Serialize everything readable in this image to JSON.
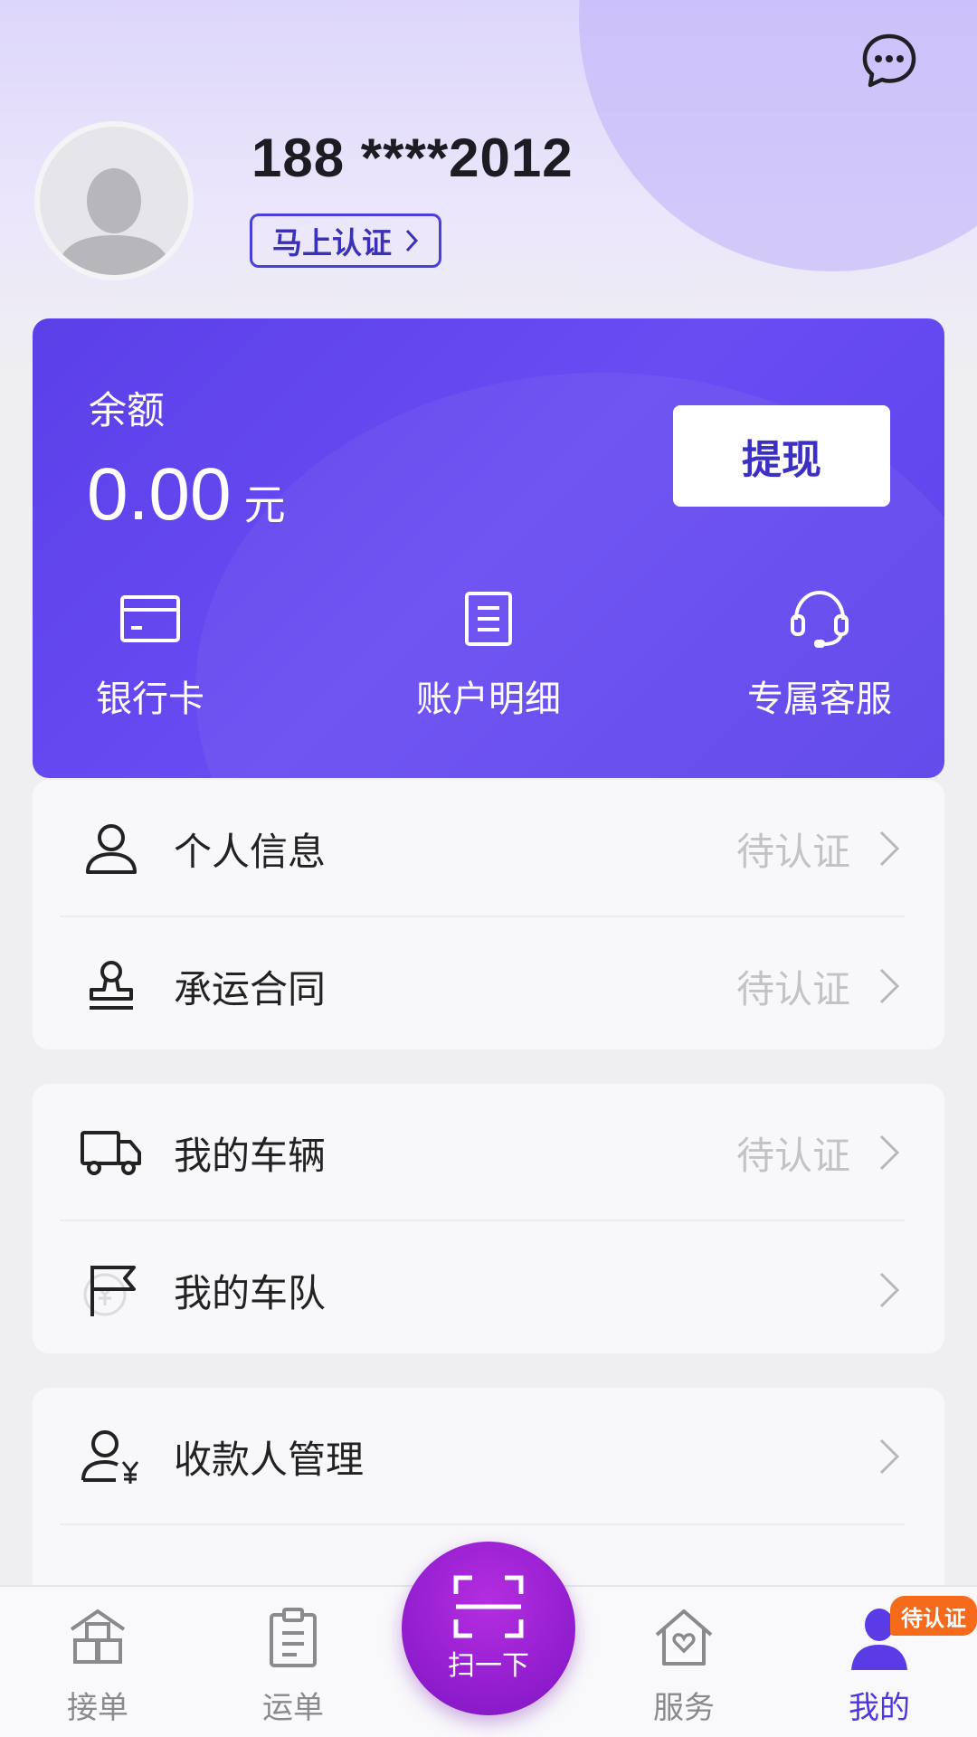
{
  "header": {
    "phone": "188 ****2012",
    "verify_label": "马上认证"
  },
  "balance": {
    "label": "余额",
    "amount": "0.00",
    "unit": "元",
    "withdraw_label": "提现",
    "actions": [
      {
        "label": "银行卡",
        "icon": "credit-card-icon"
      },
      {
        "label": "账户明细",
        "icon": "document-icon"
      },
      {
        "label": "专属客服",
        "icon": "headset-icon"
      }
    ]
  },
  "menu_groups": [
    [
      {
        "label": "个人信息",
        "status": "待认证",
        "icon": "person-icon"
      },
      {
        "label": "承运合同",
        "status": "待认证",
        "icon": "stamp-icon"
      }
    ],
    [
      {
        "label": "我的车辆",
        "status": "待认证",
        "icon": "truck-icon"
      },
      {
        "label": "我的车队",
        "status": "",
        "icon": "flag-icon"
      }
    ],
    [
      {
        "label": "收款人管理",
        "status": "",
        "icon": "payee-icon"
      }
    ]
  ],
  "tabbar": {
    "tabs": [
      {
        "label": "接单",
        "icon": "boxes-icon"
      },
      {
        "label": "运单",
        "icon": "clipboard-icon"
      },
      {
        "label": "服务",
        "icon": "house-heart-icon"
      },
      {
        "label": "我的",
        "icon": "person-icon",
        "active": true
      }
    ],
    "scan_label": "扫一下",
    "me_badge": "待认证"
  },
  "colors": {
    "accent": "#5b3fe8",
    "scan": "#9b22d4",
    "badge": "#f56a1b"
  }
}
